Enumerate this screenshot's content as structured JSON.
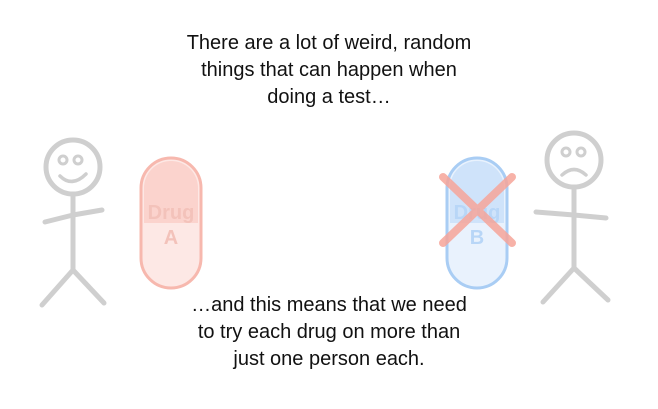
{
  "caption_top": {
    "lines": [
      "There are a lot of weird, random",
      "things that can happen when",
      "doing a test…"
    ]
  },
  "caption_bottom": {
    "lines": [
      "…and this means that we need",
      "to try each drug on more than",
      "just one person each."
    ]
  },
  "pill_a": {
    "line1": "Drug",
    "line2": "A",
    "color": "#f7b8ae",
    "text_color": "#f3c2ba"
  },
  "pill_b": {
    "line1": "Drug",
    "line2": "B",
    "color": "#a9cdf4",
    "text_color": "#b8d6f7",
    "cross_color": "#f6a59a"
  },
  "figures": {
    "left_person": "happy",
    "right_person": "sad",
    "stroke_color": "#cfcfcf"
  }
}
